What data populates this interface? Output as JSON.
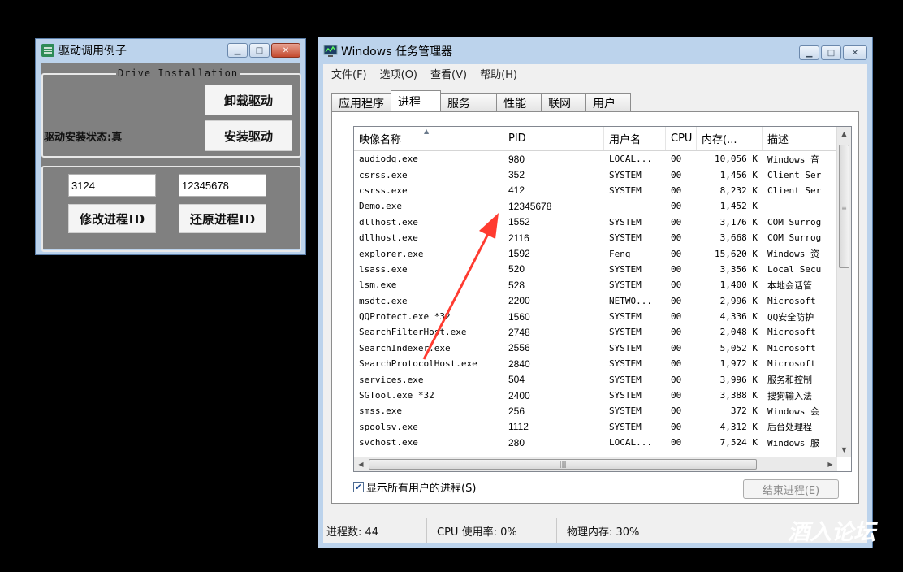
{
  "driver_window": {
    "title": "驱动调用例子",
    "group_label": "Drive Installation",
    "uninstall_button": "卸载驱动",
    "install_button": "安装驱动",
    "status_label": "驱动安装状态:真",
    "pid_input_value": "3124",
    "new_pid_input_value": "12345678",
    "modify_button": "修改进程ID",
    "restore_button": "还原进程ID"
  },
  "task_manager": {
    "title": "Windows 任务管理器",
    "menu": [
      "文件(F)",
      "选项(O)",
      "查看(V)",
      "帮助(H)"
    ],
    "tabs": [
      "应用程序",
      "进程",
      "服务",
      "性能",
      "联网",
      "用户"
    ],
    "active_tab": "进程",
    "columns": [
      "映像名称",
      "PID",
      "用户名",
      "CPU",
      "内存(...",
      "描述"
    ],
    "rows": [
      [
        "audiodg.exe",
        "980",
        "LOCAL...",
        "00",
        "10,056 K",
        "Windows 音"
      ],
      [
        "csrss.exe",
        "352",
        "SYSTEM",
        "00",
        "1,456 K",
        "Client Ser"
      ],
      [
        "csrss.exe",
        "412",
        "SYSTEM",
        "00",
        "8,232 K",
        "Client Ser"
      ],
      [
        "Demo.exe",
        "12345678",
        "",
        "00",
        "1,452 K",
        ""
      ],
      [
        "dllhost.exe",
        "1552",
        "SYSTEM",
        "00",
        "3,176 K",
        "COM Surrog"
      ],
      [
        "dllhost.exe",
        "2116",
        "SYSTEM",
        "00",
        "3,668 K",
        "COM Surrog"
      ],
      [
        "explorer.exe",
        "1592",
        "Feng",
        "00",
        "15,620 K",
        "Windows 资"
      ],
      [
        "lsass.exe",
        "520",
        "SYSTEM",
        "00",
        "3,356 K",
        "Local Secu"
      ],
      [
        "lsm.exe",
        "528",
        "SYSTEM",
        "00",
        "1,400 K",
        "本地会话管"
      ],
      [
        "msdtc.exe",
        "2200",
        "NETWO...",
        "00",
        "2,996 K",
        "Microsoft"
      ],
      [
        "QQProtect.exe *32",
        "1560",
        "SYSTEM",
        "00",
        "4,336 K",
        "QQ安全防护"
      ],
      [
        "SearchFilterHost.exe",
        "2748",
        "SYSTEM",
        "00",
        "2,048 K",
        "Microsoft"
      ],
      [
        "SearchIndexer.exe",
        "2556",
        "SYSTEM",
        "00",
        "5,052 K",
        "Microsoft"
      ],
      [
        "SearchProtocolHost.exe",
        "2840",
        "SYSTEM",
        "00",
        "1,972 K",
        "Microsoft"
      ],
      [
        "services.exe",
        "504",
        "SYSTEM",
        "00",
        "3,996 K",
        "服务和控制"
      ],
      [
        "SGTool.exe *32",
        "2400",
        "SYSTEM",
        "00",
        "3,388 K",
        "搜狗输入法"
      ],
      [
        "smss.exe",
        "256",
        "SYSTEM",
        "00",
        "372 K",
        "Windows 会"
      ],
      [
        "spoolsv.exe",
        "1112",
        "SYSTEM",
        "00",
        "4,312 K",
        "后台处理程"
      ],
      [
        "svchost.exe",
        "280",
        "LOCAL...",
        "00",
        "7,524 K",
        "Windows 服"
      ]
    ],
    "show_all_users_label": "显示所有用户的进程(S)",
    "show_all_users_checked": true,
    "end_process_button": "结束进程(E)",
    "status": {
      "processes": "进程数: 44",
      "cpu": "CPU 使用率: 0%",
      "memory": "物理内存: 30%"
    }
  },
  "watermark": "酒入论坛",
  "colors": {
    "arrow": "#ff3b30",
    "driver_client": "#808080",
    "window_frame": "#bcd3ec"
  }
}
